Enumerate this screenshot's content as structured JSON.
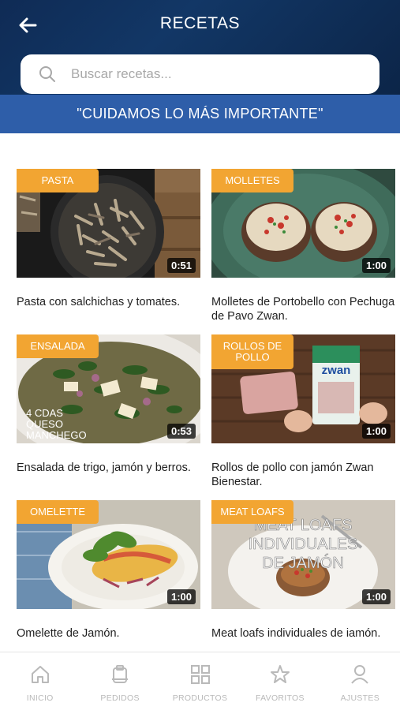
{
  "header": {
    "title": "RECETAS",
    "back_icon": "arrow-left-icon"
  },
  "search": {
    "placeholder": "Buscar recetas...",
    "value": "",
    "icon": "search-icon"
  },
  "banner": {
    "text": "\"CUIDAMOS LO MÁS IMPORTANTE\"",
    "color": "#2e5ea9"
  },
  "accent_color": "#f2a532",
  "recipes": [
    {
      "tag": "PASTA",
      "duration": "0:51",
      "title": "Pasta con salchichas y tomates."
    },
    {
      "tag": "MOLLETES",
      "duration": "1:00",
      "title": "Molletes de Portobello con Pechuga de Pavo Zwan."
    },
    {
      "tag": "ENSALADA",
      "duration": "0:53",
      "title": "Ensalada de trigo, jamón y berros.",
      "overlay": "4 CDAS QUESO MANCHEGO"
    },
    {
      "tag": "ROLLOS DE POLLO",
      "duration": "1:00",
      "title": "Rollos de pollo con jamón Zwan Bienestar.",
      "overlay": "zwan"
    },
    {
      "tag": "OMELETTE",
      "duration": "1:00",
      "title": "Omelette de Jamón."
    },
    {
      "tag": "MEAT LOAFS",
      "duration": "1:00",
      "title": "Meat loafs individuales de iamón.",
      "overlay": "MEAT LOAFS INDIVIDUALES DE JAMÓN"
    }
  ],
  "nav": [
    {
      "label": "INICIO",
      "icon": "home-icon"
    },
    {
      "label": "PEDIDOS",
      "icon": "orders-icon"
    },
    {
      "label": "PRODUCTOS",
      "icon": "grid-icon"
    },
    {
      "label": "FAVORITOS",
      "icon": "star-icon"
    },
    {
      "label": "AJUSTES",
      "icon": "user-icon"
    }
  ]
}
